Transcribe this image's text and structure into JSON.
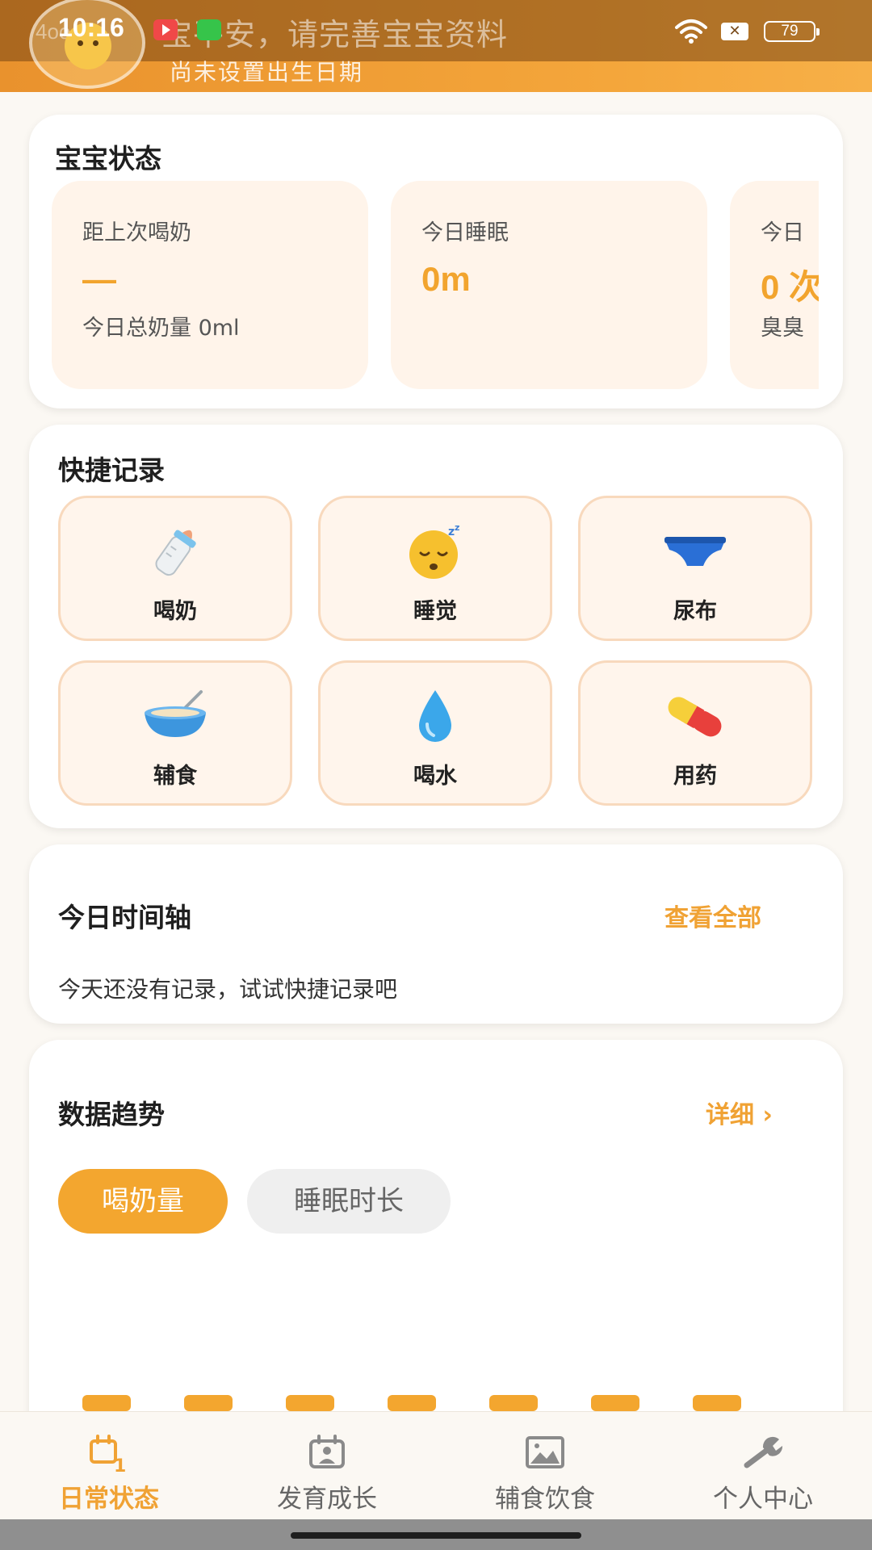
{
  "status_bar": {
    "time": "10:16",
    "battery": "79"
  },
  "header": {
    "avatar_faint_text": "4oo",
    "greeting": "宝平安，请完善宝宝资料",
    "birth_note": "尚未设置出生日期"
  },
  "baby_status": {
    "title": "宝宝状态",
    "cards": [
      {
        "label": "距上次喝奶",
        "value": "—",
        "sub": "今日总奶量 0ml"
      },
      {
        "label": "今日睡眠",
        "value": "0m",
        "sub": ""
      },
      {
        "label": "今日",
        "value": "0 次",
        "sub": "臭臭"
      }
    ]
  },
  "quick_record": {
    "title": "快捷记录",
    "items": [
      {
        "label": "喝奶",
        "icon": "baby-bottle-icon"
      },
      {
        "label": "睡觉",
        "icon": "sleeping-face-icon"
      },
      {
        "label": "尿布",
        "icon": "diaper-icon"
      },
      {
        "label": "辅食",
        "icon": "food-bowl-icon"
      },
      {
        "label": "喝水",
        "icon": "water-drop-icon"
      },
      {
        "label": "用药",
        "icon": "pill-icon"
      }
    ]
  },
  "timeline": {
    "title": "今日时间轴",
    "view_all": "查看全部",
    "empty": "今天还没有记录，试试快捷记录吧"
  },
  "trend": {
    "title": "数据趋势",
    "detail": "详细 ›",
    "tabs": [
      "喝奶量",
      "睡眠时长"
    ],
    "active_tab": "喝奶量",
    "bar_count": 7
  },
  "bottom_nav": {
    "items": [
      {
        "label": "日常状态",
        "icon": "calendar-icon",
        "active": true
      },
      {
        "label": "发育成长",
        "icon": "growth-photo-icon",
        "active": false
      },
      {
        "label": "辅食饮食",
        "icon": "image-icon",
        "active": false
      },
      {
        "label": "个人中心",
        "icon": "wrench-icon",
        "active": false
      }
    ]
  },
  "colors": {
    "accent": "#f3a62f",
    "card_tint": "#fff4ea",
    "header_orange": "#f4a63b"
  }
}
